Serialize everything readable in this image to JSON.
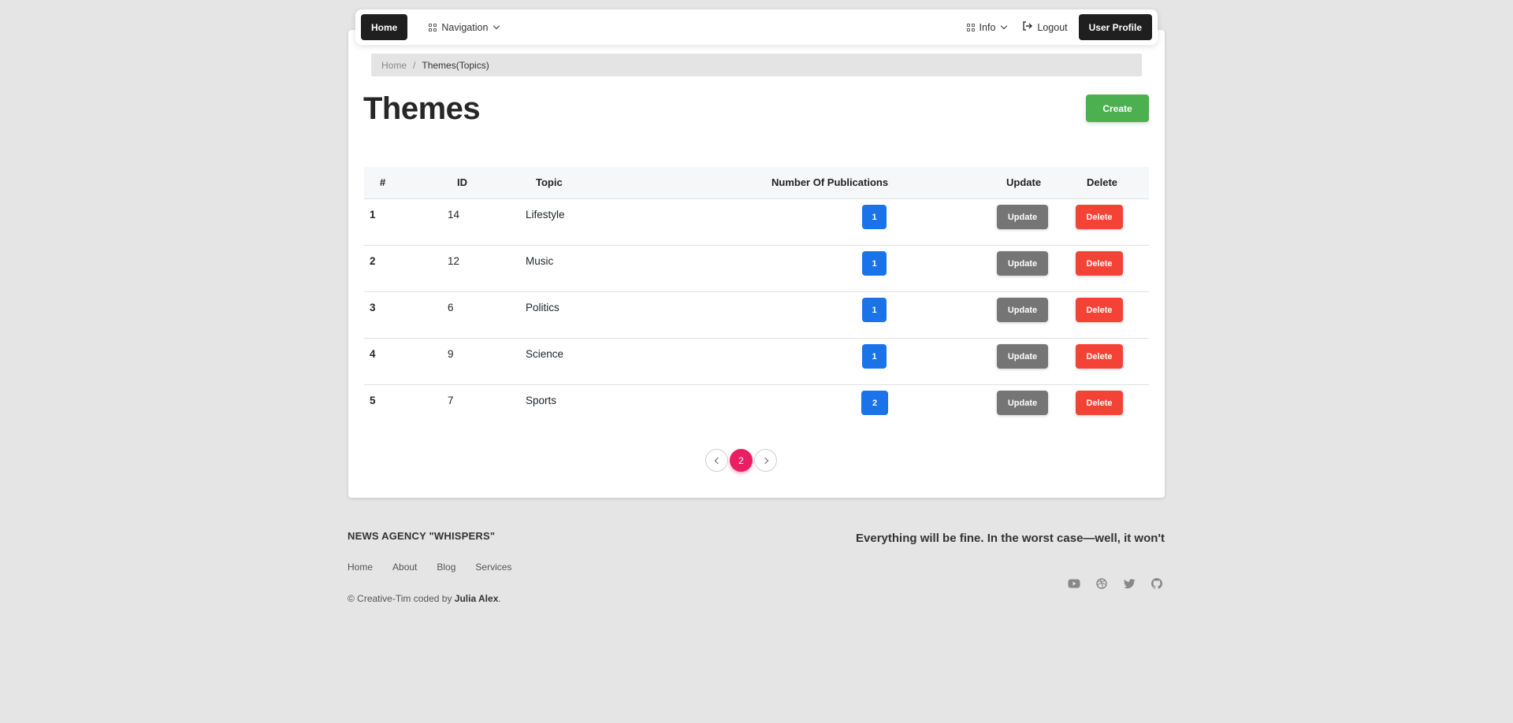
{
  "navbar": {
    "home_label": "Home",
    "navigation_label": "Navigation",
    "info_label": "Info",
    "logout_label": "Logout",
    "profile_label": "User Profile"
  },
  "breadcrumb": {
    "home": "Home",
    "separator": "/",
    "current": "Themes(Topics)"
  },
  "page": {
    "title": "Themes",
    "create_label": "Create"
  },
  "table": {
    "headers": {
      "num": "#",
      "id": "ID",
      "topic": "Topic",
      "publications": "Number Of Publications",
      "update": "Update",
      "delete": "Delete"
    },
    "rows": [
      {
        "num": "1",
        "id": "14",
        "topic": "Lifestyle",
        "publications": "1",
        "update": "Update",
        "delete": "Delete"
      },
      {
        "num": "2",
        "id": "12",
        "topic": "Music",
        "publications": "1",
        "update": "Update",
        "delete": "Delete"
      },
      {
        "num": "3",
        "id": "6",
        "topic": "Politics",
        "publications": "1",
        "update": "Update",
        "delete": "Delete"
      },
      {
        "num": "4",
        "id": "9",
        "topic": "Science",
        "publications": "1",
        "update": "Update",
        "delete": "Delete"
      },
      {
        "num": "5",
        "id": "7",
        "topic": "Sports",
        "publications": "2",
        "update": "Update",
        "delete": "Delete"
      }
    ]
  },
  "pagination": {
    "current_page": "2"
  },
  "footer": {
    "brand": "NEWS AGENCY \"WHISPERS\"",
    "links": [
      "Home",
      "About",
      "Blog",
      "Services"
    ],
    "copyright_prefix": "© Creative-Tim coded by ",
    "author": "Julia Alex",
    "copyright_suffix": ".",
    "quote": "Everything will be fine. In the worst case—well, it won't",
    "socials": [
      "youtube-icon",
      "dribbble-icon",
      "twitter-icon",
      "github-icon"
    ]
  },
  "colors": {
    "primary_blue": "#1a73e8",
    "success": "#4caf50",
    "danger": "#f44336",
    "secondary": "#757575",
    "pagination_active": "#e91e63",
    "dark": "#1f1f1f"
  }
}
